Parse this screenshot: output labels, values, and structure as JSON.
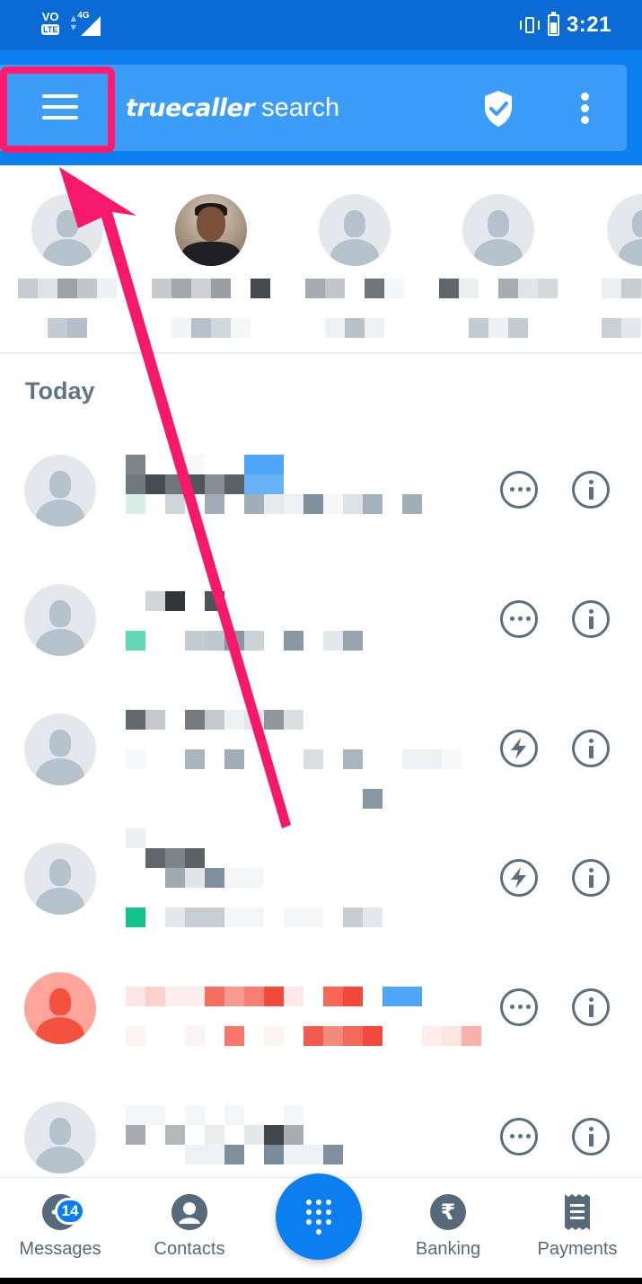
{
  "status_bar": {
    "volte_label": "VO",
    "lte_label": "LTE",
    "network_label": "4G",
    "time": "3:21"
  },
  "header": {
    "brand_logo": "truecaller",
    "brand_word": "search",
    "icons": [
      "menu-icon",
      "shield-check-icon",
      "more-vertical-icon"
    ],
    "highlight_color": "#ff1a6e"
  },
  "frequent_contacts": {
    "count": 5,
    "avatars": [
      "default-avatar",
      "photo-avatar",
      "default-avatar",
      "default-avatar",
      "default-avatar"
    ]
  },
  "call_log": {
    "section_title": "Today",
    "rows": [
      {
        "avatar": "default-avatar",
        "action_icon": "message-icon"
      },
      {
        "avatar": "default-avatar",
        "action_icon": "message-icon"
      },
      {
        "avatar": "default-avatar",
        "action_icon": "flash-icon"
      },
      {
        "avatar": "default-avatar",
        "action_icon": "flash-icon"
      },
      {
        "avatar": "spam-avatar",
        "action_icon": "message-icon"
      },
      {
        "avatar": "default-avatar",
        "action_icon": "message-icon"
      }
    ]
  },
  "bottom_nav": {
    "messages_label": "Messages",
    "messages_badge": "14",
    "contacts_label": "Contacts",
    "banking_label": "Banking",
    "banking_symbol": "₹",
    "payments_label": "Payments"
  },
  "colors": {
    "primary": "#0b7ff0",
    "status_bar": "#0a6bd6",
    "search_bar": "#3c9df8",
    "annotation_arrow": "#f5186b",
    "icon_gray": "#5a6f7e",
    "spam_red": "#f4523f"
  }
}
